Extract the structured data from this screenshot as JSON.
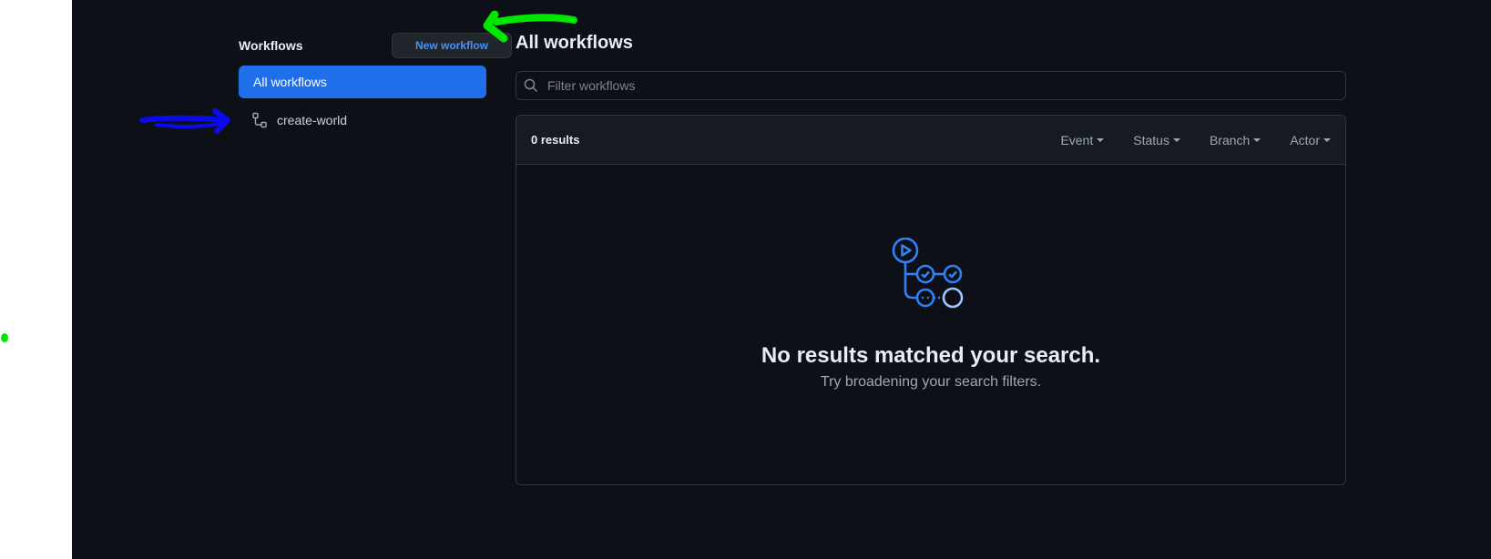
{
  "sidebar": {
    "title": "Workflows",
    "new_workflow_label": "New workflow",
    "items": [
      {
        "label": "All workflows",
        "active": true
      },
      {
        "label": "create-world",
        "icon": "workflow-icon"
      }
    ]
  },
  "main": {
    "title": "All workflows",
    "filter": {
      "placeholder": "Filter workflows",
      "value": "",
      "icon": "search-icon"
    },
    "results": {
      "count_label": "0 results",
      "filters": [
        "Event",
        "Status",
        "Branch",
        "Actor"
      ]
    },
    "empty_state": {
      "icon": "actions-workflow-icon",
      "title": "No results matched your search.",
      "subtitle": "Try broadening your search filters."
    }
  },
  "colors": {
    "background": "#0d1117",
    "accent": "#1f6feb",
    "link": "#4493f8",
    "annotation_green": "#00e600",
    "annotation_blue": "#0a0af0"
  }
}
